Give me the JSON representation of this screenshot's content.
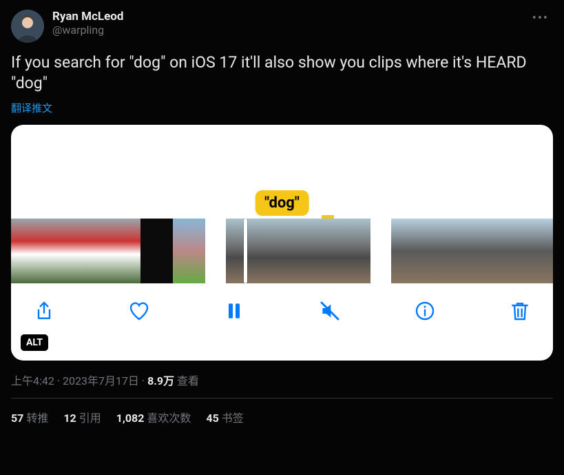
{
  "user": {
    "display_name": "Ryan McLeod",
    "handle": "@warpling"
  },
  "tweet_text": "If you search for \"dog\" on iOS 17 it'll also show you clips where it's HEARD \"dog\"",
  "translate_label": "翻译推文",
  "media": {
    "search_tag": "\"dog\"",
    "alt_badge": "ALT"
  },
  "meta": {
    "time": "上午4:42",
    "date": "2023年7月17日",
    "views_number": "8.9万",
    "views_label": "查看"
  },
  "stats": {
    "retweets_count": "57",
    "retweets_label": "转推",
    "quotes_count": "12",
    "quotes_label": "引用",
    "likes_count": "1,082",
    "likes_label": "喜欢次数",
    "bookmarks_count": "45",
    "bookmarks_label": "书签"
  },
  "more_label": "•••"
}
